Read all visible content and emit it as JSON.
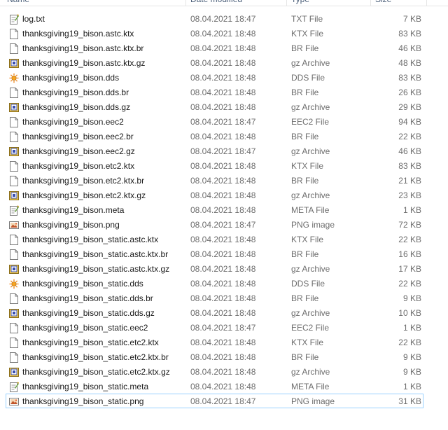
{
  "columns": {
    "name": "Name",
    "date": "Date modified",
    "type": "Type",
    "size": "Size"
  },
  "selected_index": 26,
  "files": [
    {
      "name": "log.txt",
      "date": "08.04.2021 18:47",
      "type": "TXT File",
      "size": "7 KB",
      "icon": "text-file-icon"
    },
    {
      "name": "thanksgiving19_bison.astc.ktx",
      "date": "08.04.2021 18:48",
      "type": "KTX File",
      "size": "83 KB",
      "icon": "blank-file-icon"
    },
    {
      "name": "thanksgiving19_bison.astc.ktx.br",
      "date": "08.04.2021 18:48",
      "type": "BR File",
      "size": "46 KB",
      "icon": "blank-file-icon"
    },
    {
      "name": "thanksgiving19_bison.astc.ktx.gz",
      "date": "08.04.2021 18:48",
      "type": "gz Archive",
      "size": "48 KB",
      "icon": "archive-file-icon"
    },
    {
      "name": "thanksgiving19_bison.dds",
      "date": "08.04.2021 18:48",
      "type": "DDS File",
      "size": "83 KB",
      "icon": "dds-file-icon"
    },
    {
      "name": "thanksgiving19_bison.dds.br",
      "date": "08.04.2021 18:48",
      "type": "BR File",
      "size": "26 KB",
      "icon": "blank-file-icon"
    },
    {
      "name": "thanksgiving19_bison.dds.gz",
      "date": "08.04.2021 18:48",
      "type": "gz Archive",
      "size": "29 KB",
      "icon": "archive-file-icon"
    },
    {
      "name": "thanksgiving19_bison.eec2",
      "date": "08.04.2021 18:47",
      "type": "EEC2 File",
      "size": "94 KB",
      "icon": "blank-file-icon"
    },
    {
      "name": "thanksgiving19_bison.eec2.br",
      "date": "08.04.2021 18:48",
      "type": "BR File",
      "size": "22 KB",
      "icon": "blank-file-icon"
    },
    {
      "name": "thanksgiving19_bison.eec2.gz",
      "date": "08.04.2021 18:47",
      "type": "gz Archive",
      "size": "46 KB",
      "icon": "archive-file-icon"
    },
    {
      "name": "thanksgiving19_bison.etc2.ktx",
      "date": "08.04.2021 18:48",
      "type": "KTX File",
      "size": "83 KB",
      "icon": "blank-file-icon"
    },
    {
      "name": "thanksgiving19_bison.etc2.ktx.br",
      "date": "08.04.2021 18:48",
      "type": "BR File",
      "size": "21 KB",
      "icon": "blank-file-icon"
    },
    {
      "name": "thanksgiving19_bison.etc2.ktx.gz",
      "date": "08.04.2021 18:48",
      "type": "gz Archive",
      "size": "23 KB",
      "icon": "archive-file-icon"
    },
    {
      "name": "thanksgiving19_bison.meta",
      "date": "08.04.2021 18:48",
      "type": "META File",
      "size": "1 KB",
      "icon": "meta-file-icon"
    },
    {
      "name": "thanksgiving19_bison.png",
      "date": "08.04.2021 18:47",
      "type": "PNG image",
      "size": "72 KB",
      "icon": "image-file-icon"
    },
    {
      "name": "thanksgiving19_bison_static.astc.ktx",
      "date": "08.04.2021 18:48",
      "type": "KTX File",
      "size": "22 KB",
      "icon": "blank-file-icon"
    },
    {
      "name": "thanksgiving19_bison_static.astc.ktx.br",
      "date": "08.04.2021 18:48",
      "type": "BR File",
      "size": "16 KB",
      "icon": "blank-file-icon"
    },
    {
      "name": "thanksgiving19_bison_static.astc.ktx.gz",
      "date": "08.04.2021 18:48",
      "type": "gz Archive",
      "size": "17 KB",
      "icon": "archive-file-icon"
    },
    {
      "name": "thanksgiving19_bison_static.dds",
      "date": "08.04.2021 18:48",
      "type": "DDS File",
      "size": "22 KB",
      "icon": "dds-file-icon"
    },
    {
      "name": "thanksgiving19_bison_static.dds.br",
      "date": "08.04.2021 18:48",
      "type": "BR File",
      "size": "9 KB",
      "icon": "blank-file-icon"
    },
    {
      "name": "thanksgiving19_bison_static.dds.gz",
      "date": "08.04.2021 18:48",
      "type": "gz Archive",
      "size": "10 KB",
      "icon": "archive-file-icon"
    },
    {
      "name": "thanksgiving19_bison_static.eec2",
      "date": "08.04.2021 18:47",
      "type": "EEC2 File",
      "size": "1 KB",
      "icon": "blank-file-icon"
    },
    {
      "name": "thanksgiving19_bison_static.etc2.ktx",
      "date": "08.04.2021 18:48",
      "type": "KTX File",
      "size": "22 KB",
      "icon": "blank-file-icon"
    },
    {
      "name": "thanksgiving19_bison_static.etc2.ktx.br",
      "date": "08.04.2021 18:48",
      "type": "BR File",
      "size": "9 KB",
      "icon": "blank-file-icon"
    },
    {
      "name": "thanksgiving19_bison_static.etc2.ktx.gz",
      "date": "08.04.2021 18:48",
      "type": "gz Archive",
      "size": "9 KB",
      "icon": "archive-file-icon"
    },
    {
      "name": "thanksgiving19_bison_static.meta",
      "date": "08.04.2021 18:48",
      "type": "META File",
      "size": "1 KB",
      "icon": "meta-file-icon"
    },
    {
      "name": "thanksgiving19_bison_static.png",
      "date": "08.04.2021 18:47",
      "type": "PNG image",
      "size": "31 KB",
      "icon": "image-file-icon"
    }
  ]
}
